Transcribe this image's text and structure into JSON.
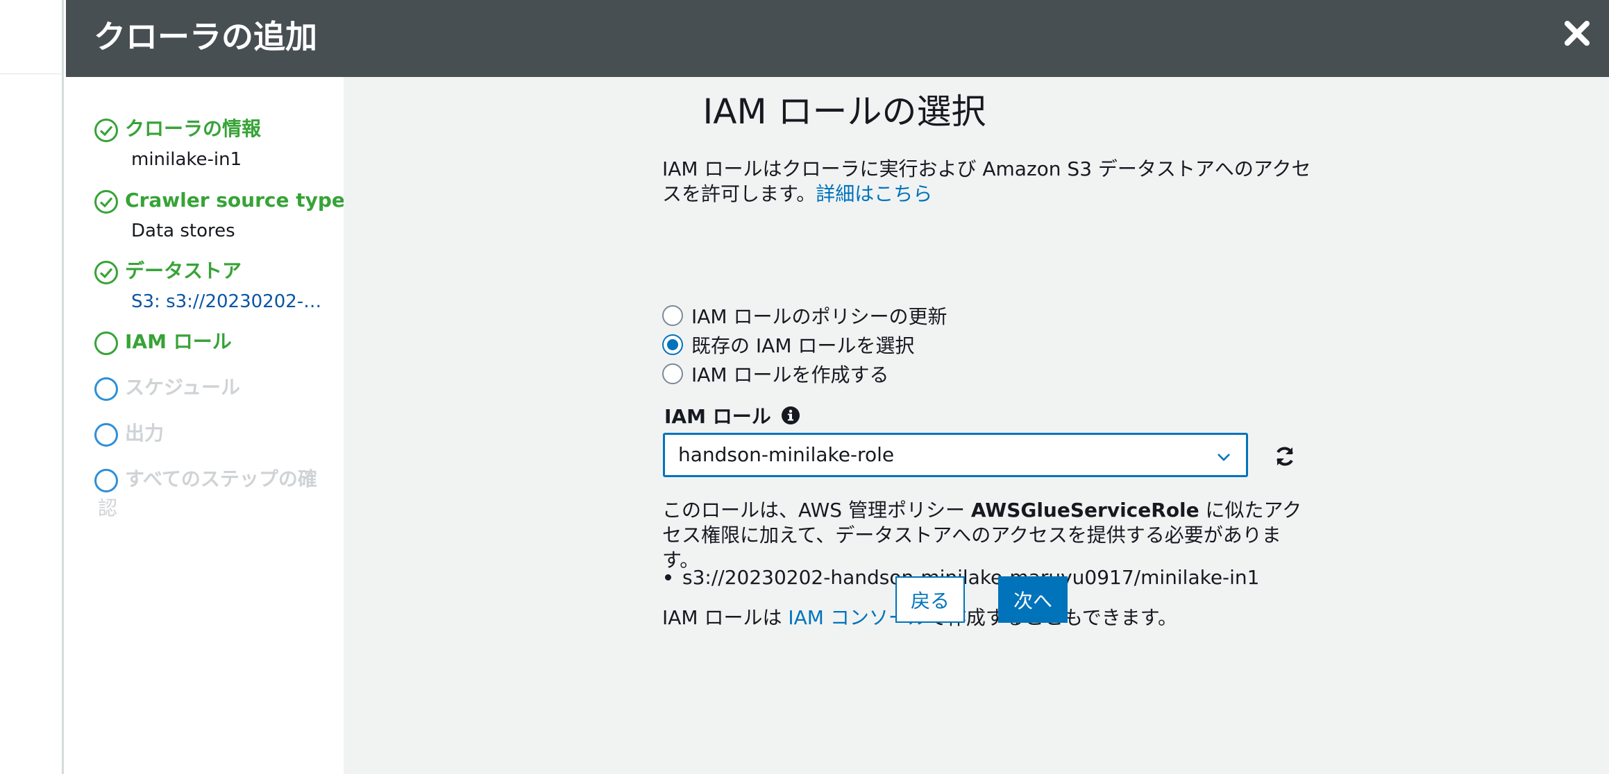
{
  "modal": {
    "title": "クローラの追加",
    "close_icon": "close-icon"
  },
  "steps": [
    {
      "label": "クローラの情報",
      "sub": "minilake-in1",
      "state": "done"
    },
    {
      "label": "Crawler source type",
      "sub": "Data stores",
      "state": "done"
    },
    {
      "label": "データストア",
      "sub": "S3: s3://20230202-…",
      "state": "done"
    },
    {
      "label": "IAM ロール",
      "sub": "",
      "state": "current"
    },
    {
      "label": "スケジュール",
      "sub": "",
      "state": "future"
    },
    {
      "label": "出力",
      "sub": "",
      "state": "future"
    },
    {
      "label": "すべてのステップの確",
      "label_line2": "認",
      "sub": "",
      "state": "future"
    }
  ],
  "main": {
    "heading": "IAM ロールの選択",
    "desc_line1": "IAM ロールはクローラに実行および Amazon S3 データストアへのアクセ",
    "desc_line2": "スを許可します。",
    "desc_link": "詳細はこちら",
    "radios": [
      {
        "label": "IAM ロールのポリシーの更新",
        "checked": false
      },
      {
        "label": "既存の IAM ロールを選択",
        "checked": true
      },
      {
        "label": "IAM ロールを作成する",
        "checked": false
      }
    ],
    "field_label": "IAM ロール",
    "select_value": "handson-minilake-role",
    "para2_prefix": "このロールは、AWS 管理ポリシー ",
    "para2_bold": "AWSGlueServiceRole",
    "para2_suffix": " に似たアクセス権限に加えて、データストアへのアクセスを提供する必要があります。",
    "bullet": "s3://20230202-handson-minilake-maruyu0917/minilake-in1",
    "para3_prefix": "IAM ロールは ",
    "para3_link": "IAM コンソール",
    "para3_suffix": "で作成することもできます。",
    "back_label": "戻る",
    "next_label": "次へ"
  },
  "colors": {
    "header": "#474f53",
    "accent": "#0073bb",
    "done": "#37a337",
    "future": "#cfd3d6"
  }
}
